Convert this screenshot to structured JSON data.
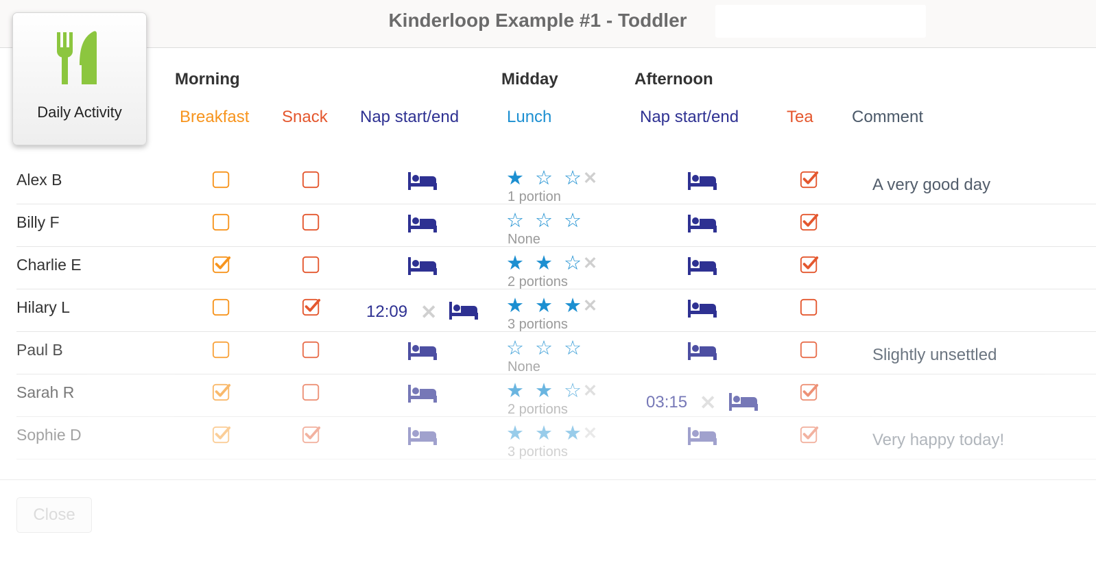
{
  "window": {
    "title": "Kinderloop Example #1 - Toddler",
    "search_placeholder": ""
  },
  "activity_card": {
    "label": "Daily Activity",
    "icon": "fork-knife-icon",
    "icon_color": "#8cc63f"
  },
  "periods": {
    "morning": "Morning",
    "midday": "Midday",
    "afternoon": "Afternoon"
  },
  "columns": {
    "breakfast": {
      "label": "Breakfast",
      "color": "#f7941d"
    },
    "snack": {
      "label": "Snack",
      "color": "#e4572e"
    },
    "nap_morning": {
      "label": "Nap start/end",
      "color": "#2e3192"
    },
    "lunch": {
      "label": "Lunch",
      "color": "#1c8fd1"
    },
    "nap_afternoon": {
      "label": "Nap start/end",
      "color": "#2e3192"
    },
    "tea": {
      "label": "Tea",
      "color": "#e4572e"
    },
    "comment": {
      "label": "Comment",
      "color": "#4a5868"
    }
  },
  "rows": [
    {
      "name": "Alex B",
      "breakfast": false,
      "snack": false,
      "nap_am_time": "",
      "lunch_stars": 1,
      "lunch_portion": "1 portion",
      "nap_pm_time": "",
      "tea": true,
      "comment": "A very good day",
      "opacity": 1
    },
    {
      "name": "Billy F",
      "breakfast": false,
      "snack": false,
      "nap_am_time": "",
      "lunch_stars": 0,
      "lunch_portion": "None",
      "nap_pm_time": "",
      "tea": true,
      "comment": "",
      "opacity": 1
    },
    {
      "name": "Charlie E",
      "breakfast": true,
      "snack": false,
      "nap_am_time": "",
      "lunch_stars": 2,
      "lunch_portion": "2 portions",
      "nap_pm_time": "",
      "tea": true,
      "comment": "",
      "opacity": 1
    },
    {
      "name": "Hilary L",
      "breakfast": false,
      "snack": true,
      "nap_am_time": "12:09",
      "lunch_stars": 3,
      "lunch_portion": "3 portions",
      "nap_pm_time": "",
      "tea": false,
      "comment": "",
      "opacity": 1
    },
    {
      "name": "Paul B",
      "breakfast": false,
      "snack": false,
      "nap_am_time": "",
      "lunch_stars": 0,
      "lunch_portion": "None",
      "nap_pm_time": "",
      "tea": false,
      "comment": "Slightly unsettled",
      "opacity": 0.85
    },
    {
      "name": "Sarah R",
      "breakfast": true,
      "snack": false,
      "nap_am_time": "",
      "lunch_stars": 2,
      "lunch_portion": "2 portions",
      "nap_pm_time": "03:15",
      "tea": true,
      "comment": "",
      "opacity": 0.65
    },
    {
      "name": "Sophie D",
      "breakfast": true,
      "snack": true,
      "nap_am_time": "",
      "lunch_stars": 3,
      "lunch_portion": "3 portions",
      "nap_pm_time": "",
      "tea": true,
      "comment": "Very happy today!",
      "opacity": 0.45
    }
  ],
  "footer": {
    "close_label": "Close"
  }
}
